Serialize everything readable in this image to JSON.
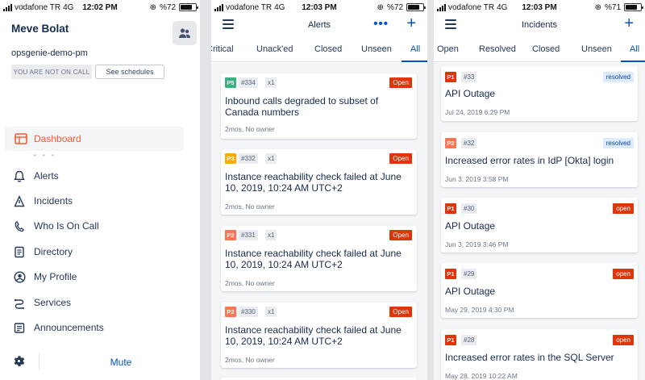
{
  "status_bars": [
    {
      "carrier": "vodafone TR",
      "network": "4G",
      "time": "12:02 PM",
      "battery": "%72"
    },
    {
      "carrier": "vodafone TR",
      "network": "4G",
      "time": "12:03 PM",
      "battery": "%72"
    },
    {
      "carrier": "vodafone TR",
      "network": "4G",
      "time": "12:03 PM",
      "battery": "%71"
    }
  ],
  "menu": {
    "user_name": "Meve Bolat",
    "org": "opsgenie-demo-pm",
    "oncall_status": "YOU ARE NOT ON CALL",
    "see_schedules": "See schedules",
    "active_item": {
      "label": "Dashboard",
      "icon": "dashboard-icon"
    },
    "items": [
      {
        "label": "Alerts",
        "icon": "bell-icon"
      },
      {
        "label": "Incidents",
        "icon": "incident-icon"
      },
      {
        "label": "Who Is On Call",
        "icon": "phone-icon"
      },
      {
        "label": "Directory",
        "icon": "directory-icon"
      },
      {
        "label": "My Profile",
        "icon": "profile-icon"
      },
      {
        "label": "Services",
        "icon": "services-icon"
      },
      {
        "label": "Announcements",
        "icon": "announcements-icon"
      }
    ],
    "mute_label": "Mute"
  },
  "alerts": {
    "title": "Alerts",
    "tabs": [
      "Critical",
      "Unack'ed",
      "Closed",
      "Unseen",
      "All"
    ],
    "active_tab": "All",
    "cards": [
      {
        "priority": "P5",
        "number": "#334",
        "count": "x1",
        "status": "Open",
        "title_lines": [
          "Inbound calls degraded to subset of",
          "Canada numbers"
        ],
        "meta": "2mos,  No owner"
      },
      {
        "priority": "P3",
        "number": "#332",
        "count": "x1",
        "status": "Open",
        "title_lines": [
          "Instance reachability check failed at June",
          "10, 2019, 10:24 AM UTC+2"
        ],
        "meta": "2mos,  No owner"
      },
      {
        "priority": "P2",
        "number": "#331",
        "count": "x1",
        "status": "Open",
        "title_lines": [
          "Instance reachability check failed at June",
          "10, 2019, 10:24 AM UTC+2"
        ],
        "meta": "2mos,  No owner"
      },
      {
        "priority": "P2",
        "number": "#330",
        "count": "x1",
        "status": "Open",
        "title_lines": [
          "Instance reachability check failed at June",
          "10, 2019, 10:24 AM UTC+2"
        ],
        "meta": "2mos,  No owner"
      }
    ]
  },
  "incidents": {
    "title": "Incidents",
    "tabs": [
      "Open",
      "Resolved",
      "Closed",
      "Unseen",
      "All"
    ],
    "active_tab": "All",
    "cards": [
      {
        "priority": "P1",
        "number": "#33",
        "status": "resolved",
        "title": "API Outage",
        "date": "Jul 24, 2019 6:29 PM"
      },
      {
        "priority": "P2",
        "number": "#32",
        "status": "resolved",
        "title": "Increased error rates in IdP [Okta] login",
        "date": "Jun 3, 2019 3:58 PM"
      },
      {
        "priority": "P1",
        "number": "#30",
        "status": "open",
        "title": "API Outage",
        "date": "Jun 3, 2019 3:46 PM"
      },
      {
        "priority": "P1",
        "number": "#29",
        "status": "open",
        "title": "API Outage",
        "date": "May 29, 2019 4:30 PM"
      },
      {
        "priority": "P1",
        "number": "#28",
        "status": "open",
        "title": "Increased error rates in the SQL Server",
        "date": "May 28, 2019 10:22 AM"
      }
    ]
  },
  "colors": {
    "accent": "#0052cc",
    "dashboard_active": "#ff5630",
    "p1": "#de350b",
    "p2": "#ff7452",
    "p3": "#ffab00",
    "p5": "#36b37e",
    "open_badge": "#de350b",
    "resolved_bg": "#deebff",
    "resolved_text": "#0747a6"
  }
}
